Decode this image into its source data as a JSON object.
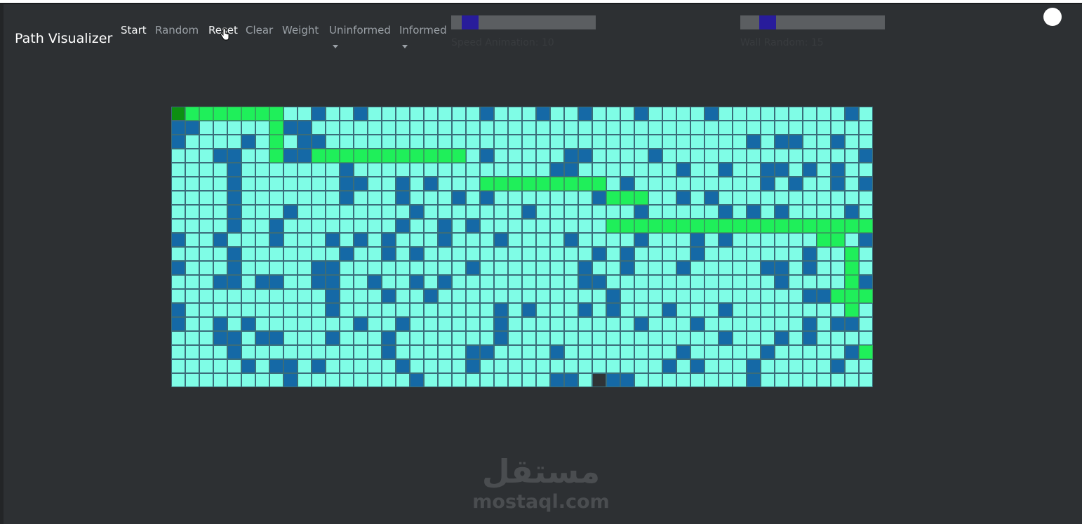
{
  "app": {
    "brand": "Path Visualizer"
  },
  "nav": [
    {
      "label": "Start",
      "active": true,
      "dropdown": false
    },
    {
      "label": "Random",
      "active": false,
      "dropdown": false
    },
    {
      "label": "Reset",
      "active": true,
      "dropdown": false
    },
    {
      "label": "Clear",
      "active": false,
      "dropdown": false
    },
    {
      "label": "Weight",
      "active": false,
      "dropdown": false
    },
    {
      "label": "Uninformed",
      "active": false,
      "dropdown": true
    },
    {
      "label": "Informed",
      "active": false,
      "dropdown": true
    }
  ],
  "sliders": [
    {
      "label": "Speed Animation: 10",
      "value": 10
    },
    {
      "label": "Wall Random: 15",
      "value": 15
    }
  ],
  "grid": {
    "rows": 20,
    "cols": 50,
    "legend": {
      ".": "empty",
      "#": "wall",
      "P": "path",
      "S": "start",
      "E": "end",
      "W": "weight"
    },
    "cells": [
      "SPPPPPPP..#..#........#...#..#...#....#.........#.",
      "##.....P##........................................",
      "#....#.P.##..............................#.##..#..",
      "...##..P##PPPPPPPPPPP.#.....##....#..............#",
      "....#.......#..............##.......#..#..##.#.#..",
      "....#.......##..#.#...PPPPPPPPP.#.........#.#..#.#",
      "....#.......#...#...#.#.......#PPP..#.#.............",
      "....#...#........#.......#.......#.....#.#.#....#..",
      "....#..#........#..#.#.........PPPPPPPPPPPPPPPPPPP#",
      "#..#...#...#.#.#...#...#....#....#...#.#......PP.#.",
      "....#.......#..#.#............#.#....#.......#..P.#",
      "#...#.....##.........#.......#..#...#.....##.#..P.#",
      "...##.##..##..#..#.#.........##............#....P#.",
      "...........#...#..#............#.............##PPP.",
      "#..........#...........#.#...#.#...#...#........P.",
      "#..#.#.......#..#......#.........#...#.......#.##.P",
      "...##.##...#...#.......#...............#...#.#....P",
      "....#..........#.....##....#........#.....#.....#P",
      ".....#.##.#.....#....#.............#.#...#.....#..P",
      "........#........#.........##.W##........#.........E"
    ]
  },
  "watermark": {
    "arabic": "مستقل",
    "latin": "mostaql.com"
  }
}
